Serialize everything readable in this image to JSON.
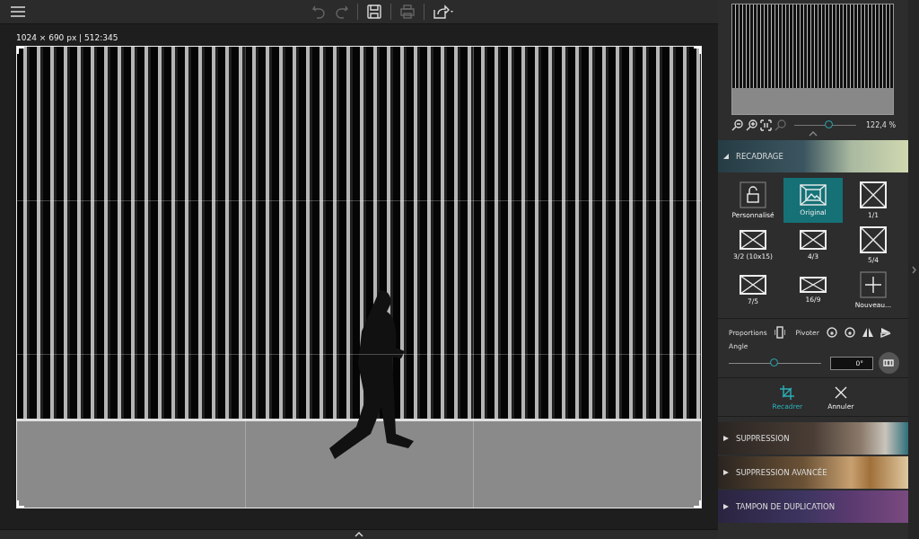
{
  "toolbar": [
    {
      "kind": "menu",
      "disabled": false
    },
    {
      "kind": "undo",
      "disabled": true
    },
    {
      "kind": "redo",
      "disabled": true
    },
    {
      "kind": "save",
      "disabled": false
    },
    {
      "kind": "print",
      "disabled": true
    },
    {
      "kind": "share",
      "disabled": false
    }
  ],
  "canvas": {
    "image_info": "1024 × 690 px | 512:345"
  },
  "navigator": {
    "zoom_slider": {
      "level": 0.57
    },
    "zoom_reading": "122,4 %"
  },
  "crop_section": {
    "title": "RECADRAGE",
    "expanded": true
  },
  "crop_presets": [
    {
      "label": "Personnalisé",
      "kind": "lock",
      "selected": false
    },
    {
      "label": "Original",
      "kind": "image",
      "selected": true
    },
    {
      "label": "1/1",
      "kind": "square",
      "selected": false
    },
    {
      "label": "3/2 (10x15)",
      "kind": "landscape",
      "selected": false
    },
    {
      "label": "4/3",
      "kind": "landscape",
      "selected": false
    },
    {
      "label": "5/4",
      "kind": "square",
      "selected": false
    },
    {
      "label": "7/5",
      "kind": "landscape",
      "selected": false
    },
    {
      "label": "16/9",
      "kind": "wide",
      "selected": false
    },
    {
      "label": "Nouveau...",
      "kind": "add",
      "selected": false
    }
  ],
  "controls": {
    "proportions_label": "Proportions",
    "rotate_label": "Pivoter",
    "angle_label": "Angle",
    "angle_slider": {
      "level": 0.5
    },
    "angle_value": "0°"
  },
  "actions": [
    {
      "label": "Recadrer",
      "kind": "crop"
    },
    {
      "label": "Annuler",
      "kind": "cancel"
    }
  ],
  "sections": [
    {
      "title": "SUPPRESSION",
      "kind": "pencil",
      "expanded": false
    },
    {
      "title": "SUPPRESSION AVANCÉE",
      "kind": "bear",
      "expanded": false
    },
    {
      "title": "TAMPON DE DUPLICATION",
      "kind": "balloons",
      "expanded": false
    }
  ]
}
